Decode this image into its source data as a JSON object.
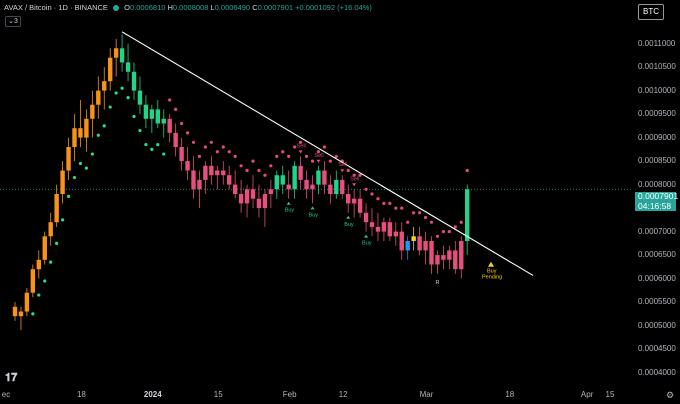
{
  "header": {
    "symbol": "AVAX / Bitcoin · 1D · BINANCE",
    "o_label": "O",
    "o_value": "0.0006810",
    "h_label": "H",
    "h_value": "0.0008008",
    "l_label": "L",
    "l_value": "0.0006490",
    "c_label": "C",
    "c_value": "0.0007901",
    "change": "+0.0001092 (+16.04%)",
    "collapse_count": "3"
  },
  "currency_badge": "BTC",
  "last_price": {
    "value": "0.0007901",
    "countdown": "04:16:58"
  },
  "colors": {
    "up": "#26a69a",
    "down": "#ef5350",
    "bull_candle": "#22d38a",
    "bear_candle": "#e64f7e",
    "early_candle": "#f7931a",
    "trend_dot_up": "#1ee38c",
    "trend_dot_down": "#e84a74",
    "trendline": "#ffffff",
    "sell": "#e64f7e",
    "buy": "#26d07c",
    "pending": "#f5d21d",
    "dotted_line": "#26a69a"
  },
  "chart_data": {
    "type": "candlestick",
    "y_ticks": [
      "0.0011000",
      "0.0010500",
      "0.0010000",
      "0.0009500",
      "0.0009000",
      "0.0008500",
      "0.0008000",
      "0.0007500",
      "0.0007000",
      "0.0006500",
      "0.0006000",
      "0.0005500",
      "0.0005000",
      "0.0004500",
      "0.0004000"
    ],
    "x_ticks": [
      {
        "label": "ec",
        "bold": false
      },
      {
        "label": "18",
        "bold": false
      },
      {
        "label": "2024",
        "bold": true
      },
      {
        "label": "15",
        "bold": false
      },
      {
        "label": "Feb",
        "bold": false
      },
      {
        "label": "12",
        "bold": false
      },
      {
        "label": "Mar",
        "bold": false
      },
      {
        "label": "18",
        "bold": false
      },
      {
        "label": "Apr",
        "bold": false
      },
      {
        "label": "15",
        "bold": false
      }
    ],
    "ylim": [
      0.00038,
      0.00118
    ],
    "candles": [
      [
        0.00054,
        0.00055,
        0.00051,
        0.00052,
        "o"
      ],
      [
        0.00052,
        0.00054,
        0.00049,
        0.00053,
        "o"
      ],
      [
        0.00053,
        0.00058,
        0.00052,
        0.00057,
        "o"
      ],
      [
        0.00057,
        0.00063,
        0.00056,
        0.00062,
        "o"
      ],
      [
        0.00062,
        0.00066,
        0.0006,
        0.00064,
        "o"
      ],
      [
        0.00064,
        0.0007,
        0.00063,
        0.00069,
        "o"
      ],
      [
        0.00069,
        0.00074,
        0.00067,
        0.00072,
        "o"
      ],
      [
        0.00072,
        0.0008,
        0.00071,
        0.00078,
        "o"
      ],
      [
        0.00078,
        0.00085,
        0.00076,
        0.00083,
        "o"
      ],
      [
        0.00083,
        0.0009,
        0.00081,
        0.00088,
        "o"
      ],
      [
        0.00088,
        0.00095,
        0.00085,
        0.00092,
        "o"
      ],
      [
        0.00092,
        0.00098,
        0.00088,
        0.0009,
        "o"
      ],
      [
        0.0009,
        0.00096,
        0.00087,
        0.00094,
        "o"
      ],
      [
        0.00094,
        0.001,
        0.0009,
        0.00097,
        "o"
      ],
      [
        0.00097,
        0.00103,
        0.00094,
        0.001,
        "o"
      ],
      [
        0.001,
        0.00105,
        0.00096,
        0.00102,
        "o"
      ],
      [
        0.00102,
        0.00109,
        0.001,
        0.00107,
        "o"
      ],
      [
        0.00107,
        0.00111,
        0.00103,
        0.00109,
        "o"
      ],
      [
        0.00109,
        0.00112,
        0.00104,
        0.00106,
        "g"
      ],
      [
        0.00106,
        0.0011,
        0.00102,
        0.00104,
        "g"
      ],
      [
        0.00104,
        0.00106,
        0.00098,
        0.001,
        "g"
      ],
      [
        0.001,
        0.00103,
        0.00095,
        0.00097,
        "g"
      ],
      [
        0.00097,
        0.00099,
        0.00092,
        0.00094,
        "g"
      ],
      [
        0.00094,
        0.00097,
        0.00091,
        0.00096,
        "g"
      ],
      [
        0.00096,
        0.00098,
        0.00092,
        0.00093,
        "g"
      ],
      [
        0.00093,
        0.00096,
        0.0009,
        0.00094,
        "g"
      ],
      [
        0.00094,
        0.00095,
        0.00089,
        0.00091,
        "r"
      ],
      [
        0.00091,
        0.00093,
        0.00086,
        0.00088,
        "r"
      ],
      [
        0.00088,
        0.0009,
        0.00083,
        0.00085,
        "r"
      ],
      [
        0.00085,
        0.00088,
        0.00081,
        0.00083,
        "r"
      ],
      [
        0.00083,
        0.00086,
        0.00077,
        0.00079,
        "r"
      ],
      [
        0.00079,
        0.00083,
        0.00075,
        0.00081,
        "r"
      ],
      [
        0.00081,
        0.00085,
        0.00078,
        0.00084,
        "r"
      ],
      [
        0.00084,
        0.00086,
        0.0008,
        0.00082,
        "r"
      ],
      [
        0.00082,
        0.00084,
        0.00079,
        0.00083,
        "r"
      ],
      [
        0.00083,
        0.00085,
        0.0008,
        0.00082,
        "r"
      ],
      [
        0.00082,
        0.00084,
        0.00079,
        0.0008,
        "r"
      ],
      [
        0.0008,
        0.00083,
        0.00077,
        0.00078,
        "r"
      ],
      [
        0.00078,
        0.00081,
        0.00074,
        0.00076,
        "r"
      ],
      [
        0.00076,
        0.0008,
        0.00073,
        0.00079,
        "r"
      ],
      [
        0.00079,
        0.00082,
        0.00075,
        0.00077,
        "r"
      ],
      [
        0.00077,
        0.0008,
        0.00073,
        0.00075,
        "r"
      ],
      [
        0.00075,
        0.00079,
        0.00071,
        0.00078,
        "r"
      ],
      [
        0.00078,
        0.00081,
        0.00075,
        0.00079,
        "r"
      ],
      [
        0.00079,
        0.00083,
        0.00077,
        0.00082,
        "g"
      ],
      [
        0.00082,
        0.00084,
        0.00078,
        0.0008,
        "g"
      ],
      [
        0.0008,
        0.00083,
        0.00077,
        0.00079,
        "r"
      ],
      [
        0.00079,
        0.00085,
        0.00077,
        0.00084,
        "g"
      ],
      [
        0.00084,
        0.00086,
        0.00079,
        0.00081,
        "r"
      ],
      [
        0.00081,
        0.00083,
        0.00077,
        0.00079,
        "r"
      ],
      [
        0.00079,
        0.00082,
        0.00076,
        0.0008,
        "r"
      ],
      [
        0.0008,
        0.00084,
        0.00078,
        0.00083,
        "g"
      ],
      [
        0.00083,
        0.00085,
        0.00078,
        0.0008,
        "r"
      ],
      [
        0.0008,
        0.00082,
        0.00076,
        0.00078,
        "r"
      ],
      [
        0.00078,
        0.00083,
        0.00077,
        0.00081,
        "g"
      ],
      [
        0.00081,
        0.00082,
        0.00077,
        0.00078,
        "r"
      ],
      [
        0.00078,
        0.0008,
        0.00074,
        0.00076,
        "r"
      ],
      [
        0.00076,
        0.00079,
        0.00073,
        0.00077,
        "r"
      ],
      [
        0.00077,
        0.00079,
        0.00073,
        0.00074,
        "r"
      ],
      [
        0.00074,
        0.00076,
        0.0007,
        0.00072,
        "r"
      ],
      [
        0.00072,
        0.00075,
        0.00069,
        0.00071,
        "r"
      ],
      [
        0.00071,
        0.00074,
        0.00068,
        0.0007,
        "r"
      ],
      [
        0.0007,
        0.00073,
        0.00068,
        0.00072,
        "r"
      ],
      [
        0.00072,
        0.00073,
        0.00068,
        0.00069,
        "r"
      ],
      [
        0.00069,
        0.00072,
        0.00067,
        0.0007,
        "r"
      ],
      [
        0.0007,
        0.00072,
        0.00064,
        0.00066,
        "r"
      ],
      [
        0.00066,
        0.00069,
        0.00064,
        0.00068,
        "b"
      ],
      [
        0.00068,
        0.00071,
        0.00066,
        0.00069,
        "y"
      ],
      [
        0.00069,
        0.00071,
        0.00065,
        0.00066,
        "r"
      ],
      [
        0.00066,
        0.0007,
        0.00063,
        0.00068,
        "r"
      ],
      [
        0.00068,
        0.00069,
        0.00061,
        0.00063,
        "r"
      ],
      [
        0.00063,
        0.00066,
        0.00061,
        0.00065,
        "r"
      ],
      [
        0.00065,
        0.00067,
        0.00062,
        0.00064,
        "r"
      ],
      [
        0.00064,
        0.00067,
        0.00062,
        0.00066,
        "r"
      ],
      [
        0.00066,
        0.00068,
        0.00061,
        0.00062,
        "r"
      ],
      [
        0.00062,
        0.00069,
        0.0006,
        0.00068,
        "r"
      ],
      [
        0.00068,
        0.0008,
        0.00065,
        0.00079,
        "g"
      ]
    ],
    "trend_line": {
      "from": [
        18,
        0.001125
      ],
      "to": [
        79,
        0.000628
      ]
    },
    "last_price_line": 0.0007901,
    "signals": [
      {
        "text": "Sell",
        "i": 48,
        "side": "sell"
      },
      {
        "text": "Sell",
        "i": 51,
        "side": "sell"
      },
      {
        "text": "Sell",
        "i": 55,
        "side": "sell"
      },
      {
        "text": "Sell",
        "i": 57,
        "side": "sell"
      },
      {
        "text": "Buy",
        "i": 46,
        "side": "buy"
      },
      {
        "text": "Buy",
        "i": 50,
        "side": "buy"
      },
      {
        "text": "Buy",
        "i": 56,
        "side": "buy"
      },
      {
        "text": "Buy",
        "i": 59,
        "side": "buy"
      },
      {
        "text": "R",
        "i": 71,
        "side": "r"
      },
      {
        "text": "Buy",
        "i": 80,
        "side": "pending"
      },
      {
        "text": "Pending",
        "i": 80,
        "side": "pending"
      }
    ]
  }
}
